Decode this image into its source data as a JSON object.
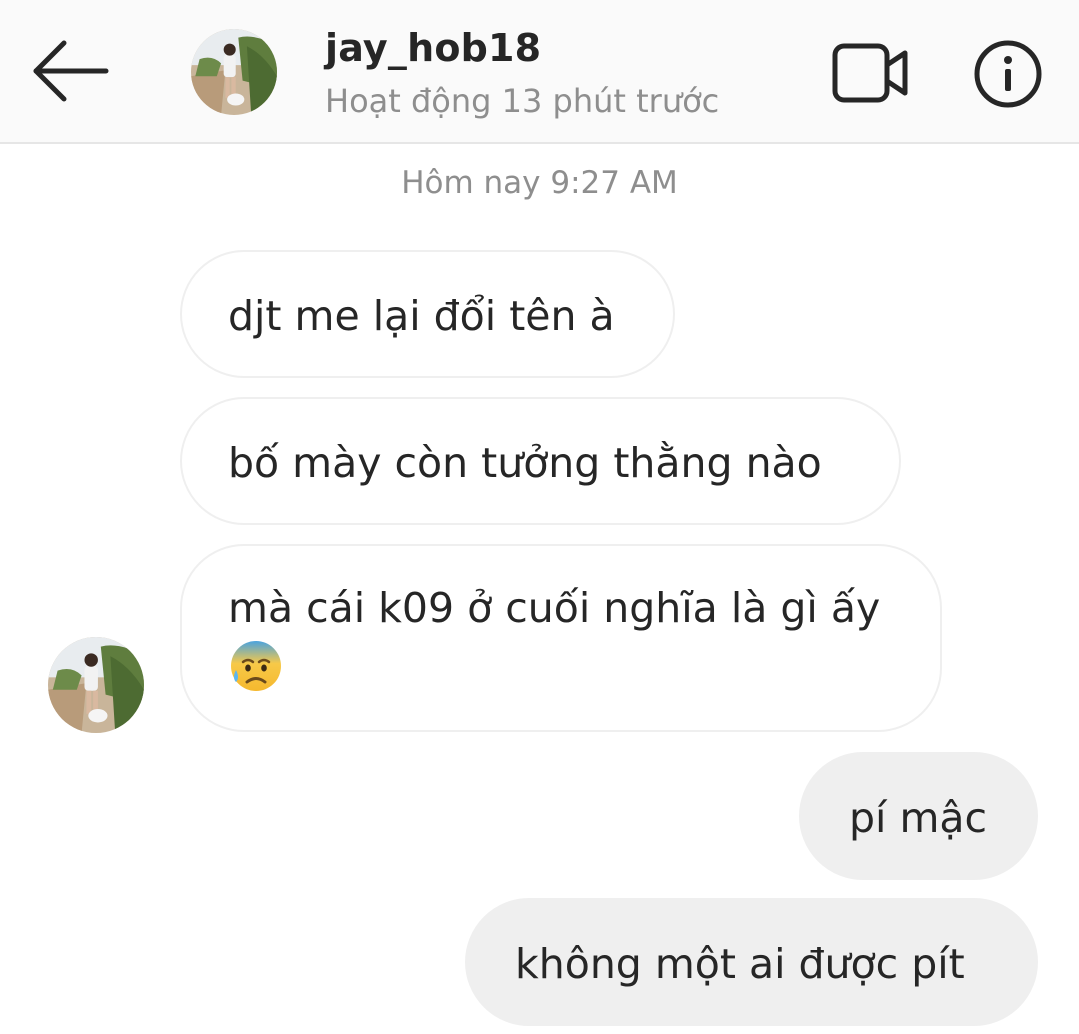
{
  "header": {
    "username": "jay_hob18",
    "status": "Hoạt động 13 phút trước",
    "back_icon": "arrow-left-icon",
    "video_icon": "video-call-icon",
    "info_icon": "info-icon"
  },
  "conversation": {
    "timestamp": "Hôm nay 9:27 AM",
    "messages": [
      {
        "sender": "other",
        "text": "djt me lại đổi tên à"
      },
      {
        "sender": "other",
        "text": "bố mày còn tưởng thằng nào"
      },
      {
        "sender": "other",
        "text": "mà cái k09 ở cuối nghĩa là gì ấy",
        "emoji": "anxious-face-with-sweat-icon"
      },
      {
        "sender": "me",
        "text": "pí mậc"
      },
      {
        "sender": "me",
        "text": "không một ai được pít"
      }
    ]
  },
  "colors": {
    "header_bg": "#fafafa",
    "incoming_bubble_bg": "#ffffff",
    "outgoing_bubble_bg": "#efefef",
    "secondary_text": "#8e8e8e",
    "primary_text": "#262626"
  }
}
